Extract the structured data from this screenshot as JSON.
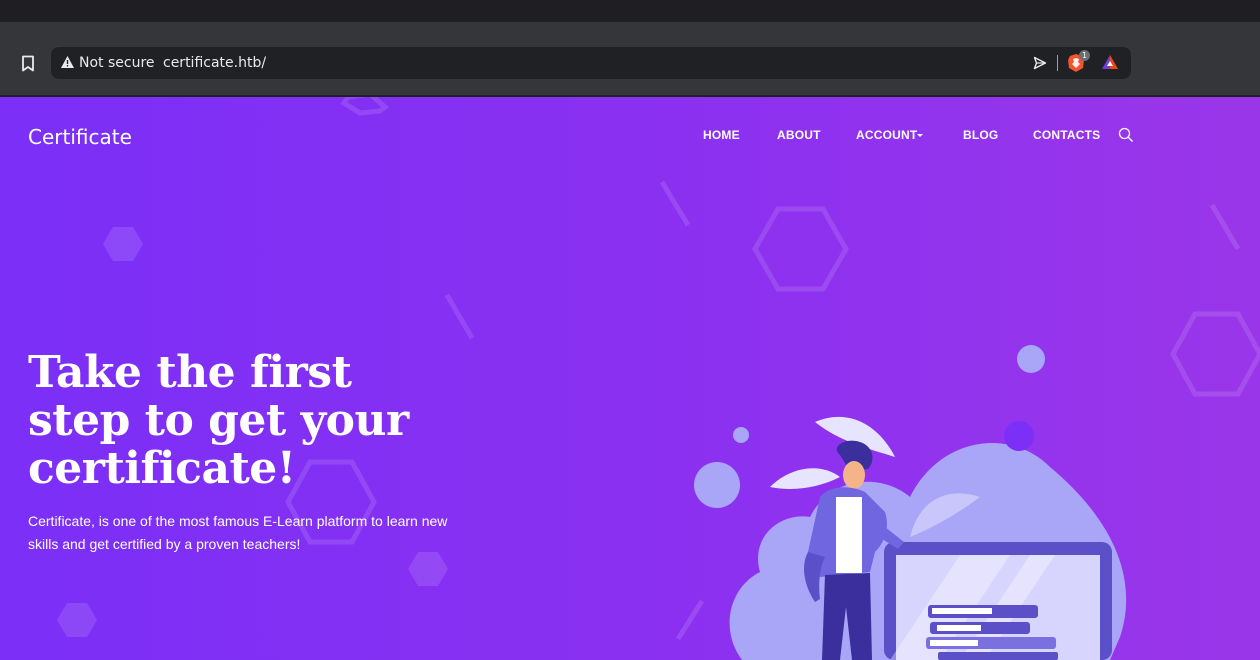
{
  "browser": {
    "security_label": "Not secure",
    "url": "certificate.htb/",
    "badge_count": "1",
    "icons": [
      "bookmark-icon",
      "warning-icon",
      "send-icon",
      "brave-shield-icon",
      "brave-rewards-icon"
    ]
  },
  "site": {
    "brand": "Certificate",
    "nav": [
      {
        "label": "HOME"
      },
      {
        "label": "ABOUT"
      },
      {
        "label": "ACCOUNT",
        "dropdown": true
      },
      {
        "label": "BLOG"
      },
      {
        "label": "CONTACTS"
      }
    ],
    "search_icon": "search-icon"
  },
  "hero": {
    "title": "Take the first step to get your certificate!",
    "subtitle": "Certificate, is one of the most famous E-Learn platform to learn new skills and get certified by a proven teachers!"
  },
  "colors": {
    "hero_bg_start": "#7b2ff7",
    "hero_bg_end": "#9a36ea",
    "chrome_bg": "#35363a",
    "address_bg": "#202124",
    "illustration_primary": "#a9a6f8",
    "illustration_dark": "#5b50c8"
  }
}
